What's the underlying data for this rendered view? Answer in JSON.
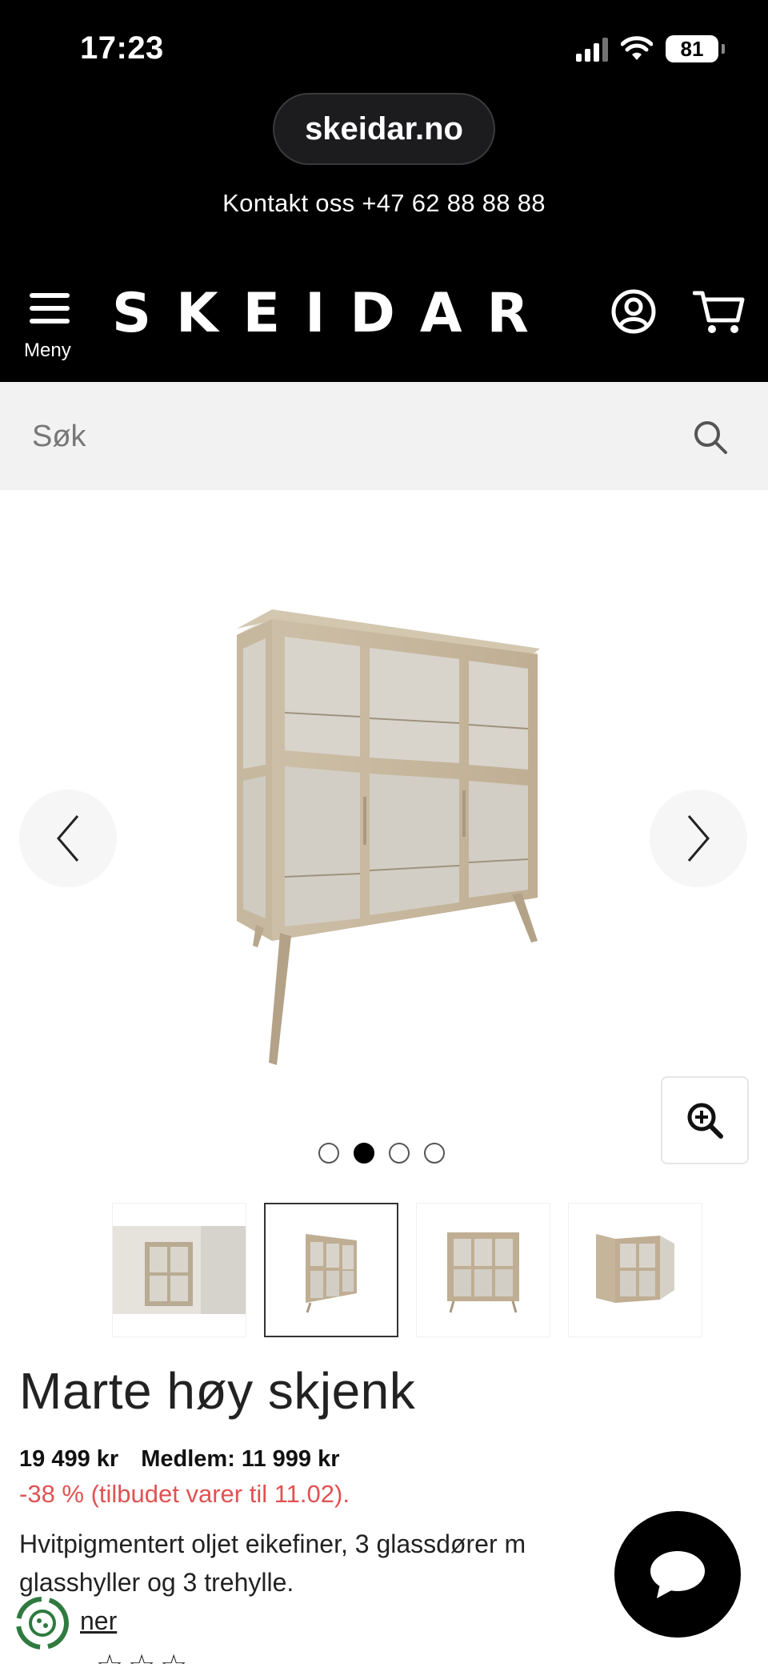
{
  "status_bar": {
    "time": "17:23",
    "battery": "81"
  },
  "browser": {
    "url": "skeidar.no"
  },
  "header": {
    "contact": "Kontakt oss +47 62 88 88 88",
    "menu_label": "Meny",
    "logo": "SKEIDAR"
  },
  "search": {
    "placeholder": "Søk"
  },
  "gallery": {
    "active_index": 2,
    "total": 4
  },
  "product": {
    "title": "Marte høy skjenk",
    "price": "19 499 kr",
    "member_price": "Medlem: 11 999 kr",
    "discount": "-38 % (tilbudet varer til 11.02).",
    "description": "Hvitpigmentert oljet eikefiner, 3 glassdører m",
    "description_line2": "glasshyller og 3 trehylle.",
    "designer_link": "ner",
    "stars_visible": "☆☆☆"
  },
  "colors": {
    "black": "#000000",
    "discount": "#e05252",
    "search_bg": "#f2f2f2"
  }
}
